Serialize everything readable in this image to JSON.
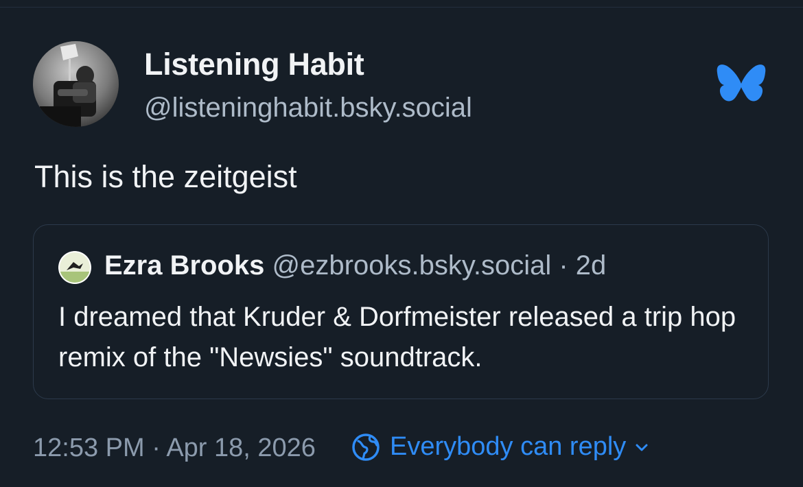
{
  "post": {
    "author": {
      "display_name": "Listening Habit",
      "handle": "@listeninghabit.bsky.social",
      "avatar_icon": "person-in-armchair-photo"
    },
    "text": "This is the zeitgeist",
    "logo_icon": "bluesky-butterfly-icon",
    "colors": {
      "background": "#161e27",
      "accent": "#2f8cf6",
      "secondary_text": "#aebbc9",
      "border": "#2c3a4b"
    }
  },
  "quote": {
    "author": {
      "display_name": "Ezra Brooks",
      "handle": "@ezbrooks.bsky.social",
      "avatar_icon": "bird-avatar"
    },
    "age": "· 2d",
    "text": "I dreamed that Kruder & Dorfmeister released a trip hop remix of the \"Newsies\" soundtrack."
  },
  "footer": {
    "timestamp": "12:53 PM · Apr 18, 2026",
    "reply_setting": "Everybody can reply",
    "reply_icon": "globe-icon",
    "chevron_icon": "chevron-down-icon"
  }
}
